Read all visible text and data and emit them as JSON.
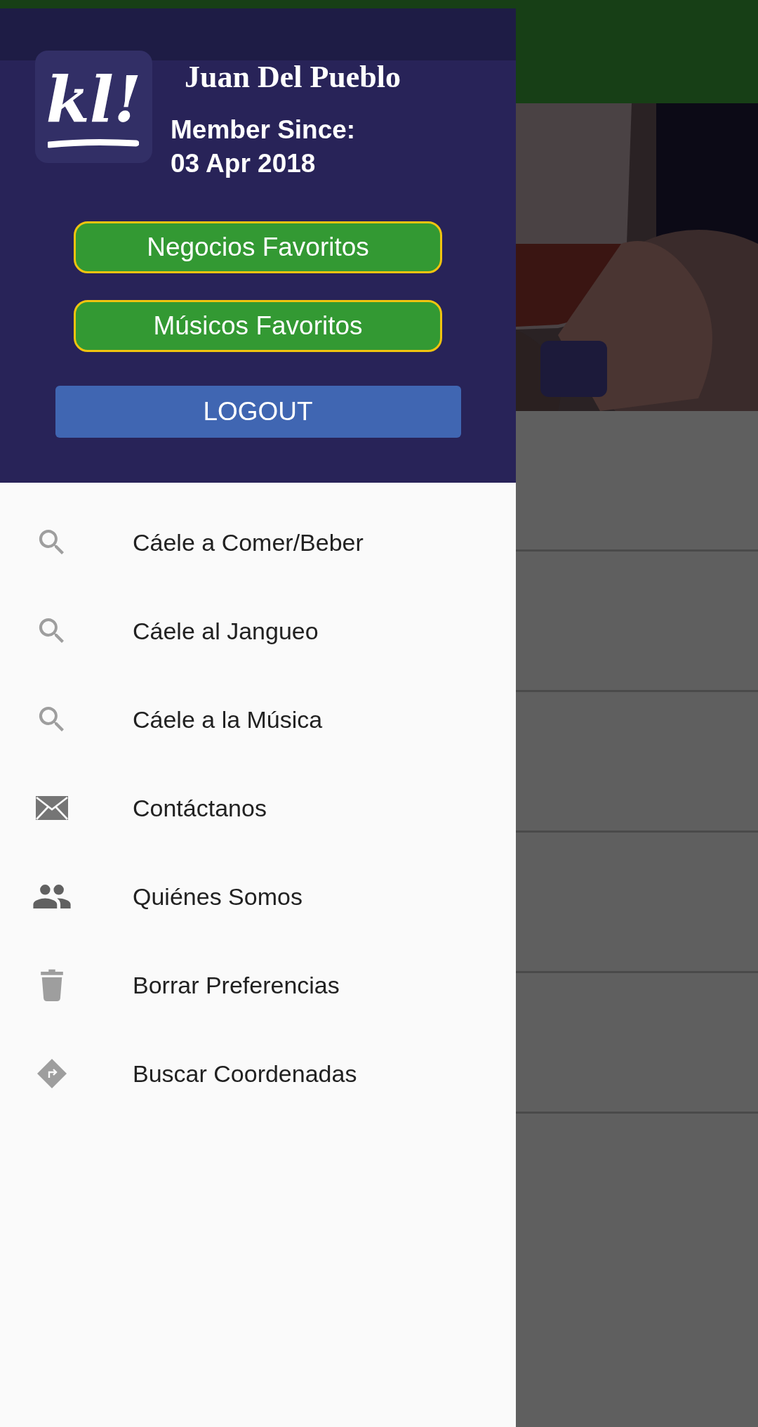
{
  "profile": {
    "logo_text": "kl!",
    "name": "Juan Del Pueblo",
    "member_since_label": "Member Since:",
    "member_since_date": "03 Apr 2018"
  },
  "favorite_buttons": [
    "Negocios Favoritos",
    "Músicos Favoritos"
  ],
  "logout_button": "LOGOUT",
  "menu": [
    {
      "label": "Cáele a Comer/Beber",
      "kind": "search"
    },
    {
      "label": "Cáele al Jangueo",
      "kind": "search"
    },
    {
      "label": "Cáele a la Música",
      "kind": "search"
    },
    {
      "label": "Contáctanos",
      "kind": "mail"
    },
    {
      "label": "Quiénes Somos",
      "kind": "people"
    },
    {
      "label": "Borrar Preferencias",
      "kind": "trash"
    },
    {
      "label": "Buscar Coordenadas",
      "kind": "directions"
    }
  ]
}
